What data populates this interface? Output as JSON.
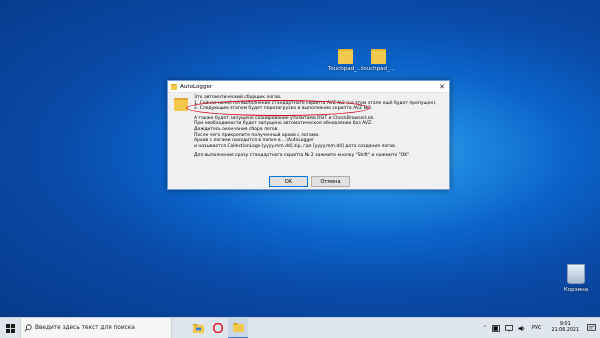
{
  "desktop": {
    "icons": [
      {
        "label": "Touchpad_..."
      },
      {
        "label": "touchpad_..."
      },
      {
        "label": "Корзина"
      }
    ]
  },
  "dialog": {
    "title": "AutoLogger",
    "close_glyph": "✕",
    "lines": [
      "Это автоматический сборщик логов.",
      "1. Сейчас начнётся выполнение стандартного скрипта AVZ №2 (на этом этапе ещё будет пропущен).",
      "2. Следующим этапом будет перезагрузка и выполнение скрипта AVZ №2.",
      "А также будет запущено сканирование утилитами RSIT и CheckBrowserLnk.",
      "При необходимости будет запущено автоматическое обновление баз AVZ.",
      "Дождитесь окончания сбора логов.",
      "После чего прикрепите полученный архив с логами.",
      "Архив с логами находится в папке в ...\\AutoLogger",
      "и называется CollectionLogs-[yyyy.mm.dd].zip, где [yyyy.mm.dd] дата создания логов.",
      "Для выполнения сразу стандартного скрипта № 2 зажмите кнопку \"Shift\" и нажмите \"OK\"."
    ],
    "ok_label": "OK",
    "cancel_label": "Отмена"
  },
  "taskbar": {
    "search_placeholder": "Введите здесь текст для поиска",
    "language": "РУС",
    "time": "9:01",
    "date": "21.06.2021"
  },
  "colors": {
    "annotation_ellipse": "#d6001c",
    "accent": "#0078d7"
  }
}
